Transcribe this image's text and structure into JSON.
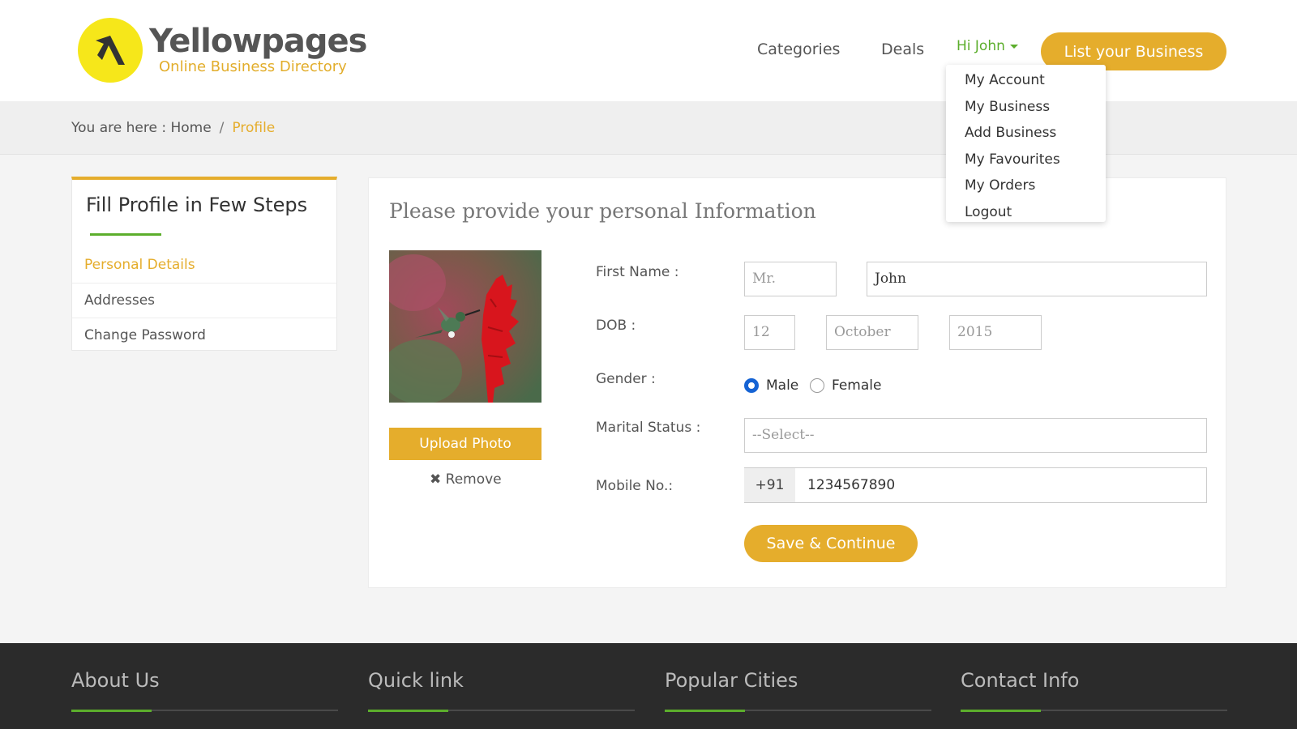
{
  "brand": {
    "name": "Yellowpages",
    "tagline": "Online Business Directory",
    "logo_color": "#f6e71a"
  },
  "nav": {
    "categories": "Categories",
    "deals": "Deals",
    "user_greeting": "Hi John",
    "list_business": "List your Business"
  },
  "user_menu": {
    "items": [
      "My Account",
      "My Business",
      "Add Business",
      "My Favourites",
      "My Orders",
      "Logout"
    ]
  },
  "breadcrumb": {
    "prefix": "You are here : Home",
    "separator": "/",
    "current": "Profile"
  },
  "sidebar": {
    "title": "Fill Profile in Few Steps",
    "steps": [
      "Personal Details",
      "Addresses",
      "Change Password"
    ],
    "active_step": "Personal Details"
  },
  "form": {
    "heading": "Please provide your personal Information",
    "upload_photo": "Upload Photo",
    "remove": "Remove",
    "labels": {
      "first_name": "First Name :",
      "dob": "DOB :",
      "gender": "Gender :",
      "marital_status": "Marital Status :",
      "mobile": "Mobile No.:"
    },
    "title_placeholder": "Mr.",
    "first_name_value": "John",
    "dob_day": "12",
    "dob_month": "October",
    "dob_year": "2015",
    "gender_options": [
      "Male",
      "Female"
    ],
    "gender_selected": "Male",
    "marital_status_value": "--Select--",
    "mobile_prefix": "+91",
    "mobile_value": "1234567890",
    "save_label": "Save & Continue"
  },
  "footer": {
    "columns": [
      "About Us",
      "Quick link",
      "Popular Cities",
      "Contact Info"
    ]
  },
  "colors": {
    "accent": "#e5ad2c",
    "green": "#5cae2c",
    "radio_blue": "#1563d4",
    "footer_bg": "#2b2b2b"
  }
}
